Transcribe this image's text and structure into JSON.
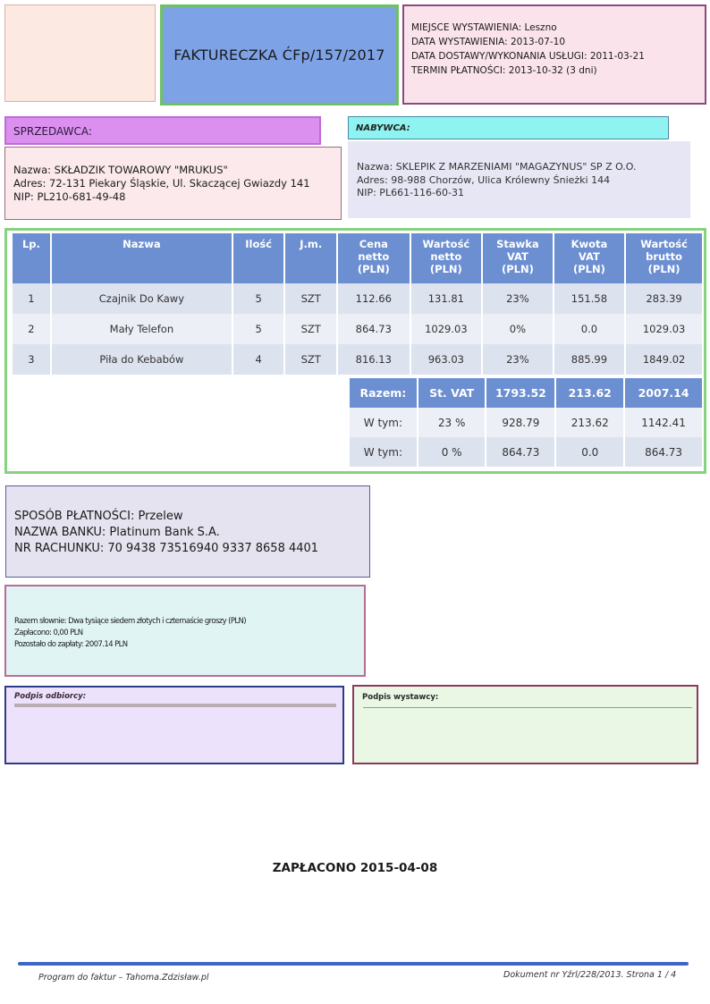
{
  "invoice": {
    "title": "FAKTURECZKA ĆFp/157/2017"
  },
  "dates": [
    "MIEJSCE WYSTAWIENIA: Leszno",
    "DATA WYSTAWIENIA: 2013-07-10",
    "DATA DOSTAWY/WYKONANIA USŁUGI: 2011-03-21",
    "TERMIN PŁATNOŚCI: 2013-10-32 (3 dni)"
  ],
  "seller": {
    "heading": "SPRZEDAWCA:",
    "name": "Nazwa: SKŁADZIK TOWAROWY \"MRUKUS\"",
    "address": "Adres: 72-131 Piekary Śląskie, Ul. Skaczącej Gwiazdy 141",
    "nip": "NIP: PL210-681-49-48"
  },
  "buyer": {
    "heading": "NABYWCA:",
    "name": "Nazwa: SKLEPIK Z MARZENIAMI \"MAGAZYNUS\" SP Z O.O.",
    "address": "Adres: 98-988 Chorzów, Ulica Królewny Śnieżki 144",
    "nip": "NIP: PL661-116-60-31"
  },
  "items": {
    "headers": [
      [
        "Lp."
      ],
      [
        "Nazwa"
      ],
      [
        "Ilość"
      ],
      [
        "J.m."
      ],
      [
        "Cena",
        "netto",
        "(PLN)"
      ],
      [
        "Wartość",
        "netto",
        "(PLN)"
      ],
      [
        "Stawka",
        "VAT",
        "(PLN)"
      ],
      [
        "Kwota",
        "VAT",
        "(PLN)"
      ],
      [
        "Wartość",
        "brutto",
        "(PLN)"
      ]
    ],
    "rows": [
      [
        "1",
        "Czajnik Do Kawy",
        "5",
        "SZT",
        "112.66",
        "131.81",
        "23%",
        "151.58",
        "283.39"
      ],
      [
        "2",
        "Mały Telefon",
        "5",
        "SZT",
        "864.73",
        "1029.03",
        "0%",
        "0.0",
        "1029.03"
      ],
      [
        "3",
        "Piła do Kebabów",
        "4",
        "SZT",
        "816.13",
        "963.03",
        "23%",
        "885.99",
        "1849.02"
      ]
    ]
  },
  "summary": {
    "rows": [
      [
        "Razem:",
        "St. VAT",
        "1793.52",
        "213.62",
        "2007.14"
      ],
      [
        "W tym:",
        "23 %",
        "928.79",
        "213.62",
        "1142.41"
      ],
      [
        "W tym:",
        "0 %",
        "864.73",
        "0.0",
        "864.73"
      ]
    ]
  },
  "payment": {
    "method": "SPOSÓB PŁATNOŚCI: Przelew",
    "bank": "NAZWA BANKU: Platinum Bank S.A.",
    "account": "NR RACHUNKU: 70 9438 73516940 9337 8658 4401"
  },
  "amount_words": {
    "words": "Razem słownie: Dwa tysiące siedem złotych i czternaście groszy (PLN)",
    "paid": "Zapłacono: 0,00 PLN",
    "remaining": "Pozostało do zapłaty: 2007.14 PLN"
  },
  "signatures": {
    "recipient": "Podpis odbiorcy:",
    "issuer": "Podpis wystawcy:"
  },
  "paid_stamp": "ZAPŁACONO 2015-04-08",
  "footer": {
    "program": "Program do faktur – Tahoma.Zdzisław.pl",
    "document": "Dokument nr Yźrl/228/2013. Strona 1 / 4"
  },
  "colors": {
    "title_bg": "#7ea2e6",
    "table_header": "#6c8fd1",
    "frame_green": "#86d37e",
    "seller_head": "#db8fef",
    "buyer_head": "#8ff3f1",
    "footer_line": "#3a66c8"
  }
}
